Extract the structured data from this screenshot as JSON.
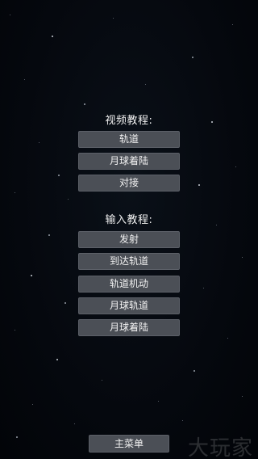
{
  "video_tutorials": {
    "title": "视频教程:",
    "items": [
      "轨道",
      "月球着陆",
      "对接"
    ]
  },
  "input_tutorials": {
    "title": "输入教程:",
    "items": [
      "发射",
      "到达轨道",
      "轨道机动",
      "月球轨道",
      "月球着陆"
    ]
  },
  "footer": {
    "main_menu_label": "主菜单"
  },
  "watermark": {
    "text": "大玩家"
  }
}
